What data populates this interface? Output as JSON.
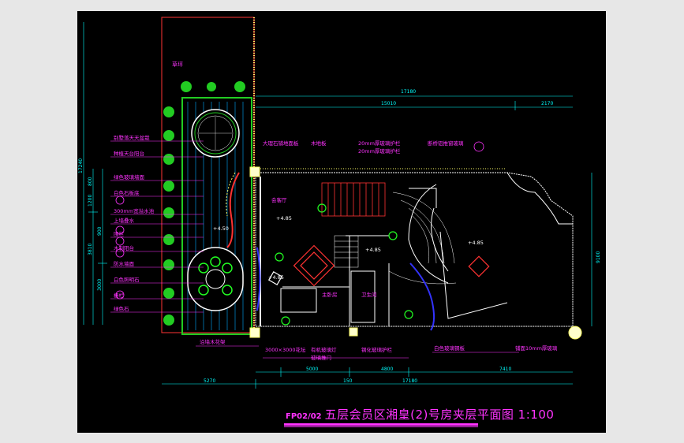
{
  "drawing": {
    "background": "#000000",
    "colors": {
      "dimension": "#00ffff",
      "label": "#ff33ff",
      "wall": "#ffffff",
      "stair": "#ff3333",
      "column": "#ffff66",
      "plant": "#22cc22",
      "glass": "#3333ff",
      "border": "#ff3333"
    }
  },
  "title": {
    "code": "FP02/02",
    "text": "五层会员区湘皇(2)号房夹层平面图 1:100"
  },
  "dimensions": {
    "top_total": "17180",
    "top_a": "15010",
    "top_b": "2170",
    "bottom_a": "5000",
    "bottom_b": "150",
    "bottom_c": "4800",
    "bottom_d": "7410",
    "bottom_total": "17180",
    "bottom_left": "5270",
    "left_total": "17240",
    "left_a": "800",
    "left_b": "1200",
    "left_c": "3810",
    "left_d": "3000",
    "left_e": "900",
    "right": "9100"
  },
  "labels": {
    "garden": "草坪",
    "g1": "别墅落天天盆栽",
    "g2": "种植天台阳台",
    "g3": "绿色玻璃墙面",
    "g4": "白色石板底",
    "g5": "300mm宽溢水池",
    "g6": "上墙叠水",
    "g7": "围栏",
    "g8": "木制阳台",
    "g9": "防水墙面",
    "g10": "白色照明石",
    "g11": "栅栏",
    "g12": "绿色石",
    "t1": "大理石铺地面板",
    "t2": "木地板",
    "t3": "20mm厚玻璃护栏",
    "t4": "20mm厚玻璃护栏",
    "t5": "断桥铝推窗玻璃",
    "room1": "会客厅",
    "room2": "主卧房",
    "room3": "卫生间",
    "b1": "沿墙木花架",
    "b2": "3000×3000花坛",
    "b3": "有机玻璃灯",
    "b4": "玻璃推门",
    "b5": "钢化玻璃护栏",
    "b6": "白色玻璃钢板",
    "b7": "铺面10mm厚玻璃",
    "lv1": "+4.85",
    "lv2": "+4.50",
    "lv3": "+4.85",
    "lv4": "+4.85",
    "lv5": "+4.85"
  }
}
